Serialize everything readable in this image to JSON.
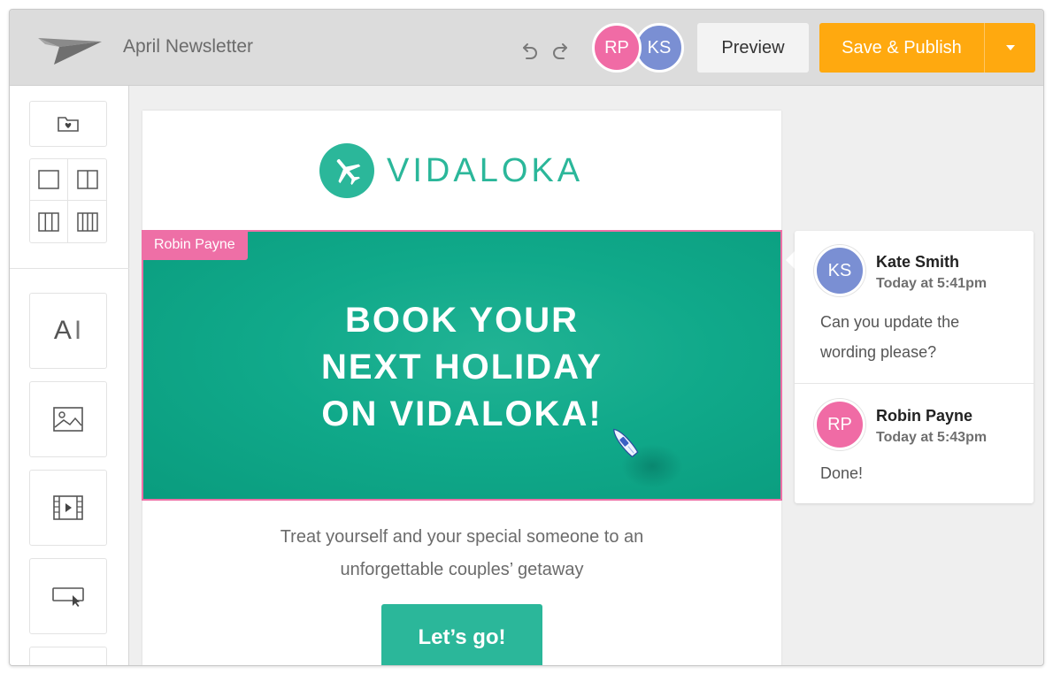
{
  "app": {
    "document_title": "April Newsletter"
  },
  "colors": {
    "accent_orange": "#ffa90f",
    "brand_teal": "#2bb79a",
    "avatar_rp": "#f06ba5",
    "avatar_ks": "#7a8fd3",
    "editor_highlight_pink": "#ee6fa6"
  },
  "toolbar": {
    "undo_icon": "undo-icon",
    "redo_icon": "redo-icon",
    "collaborators": [
      {
        "initials": "RP",
        "color": "#f06ba5"
      },
      {
        "initials": "KS",
        "color": "#7a8fd3"
      }
    ],
    "preview_label": "Preview",
    "publish_label": "Save & Publish",
    "publish_menu_icon": "caret-down-icon"
  },
  "sidebar": {
    "tools": [
      {
        "name": "saved-templates",
        "icon": "folder-heart-icon"
      },
      {
        "name": "layout-one-column",
        "icon": "layout-1col-icon"
      },
      {
        "name": "layout-two-column",
        "icon": "layout-2col-icon"
      },
      {
        "name": "layout-three-column",
        "icon": "layout-3col-icon"
      },
      {
        "name": "layout-four-column",
        "icon": "layout-4col-icon"
      },
      {
        "name": "text-block",
        "label": "A",
        "icon": "text-cursor-icon"
      },
      {
        "name": "image-block",
        "icon": "image-icon"
      },
      {
        "name": "video-block",
        "icon": "video-icon"
      },
      {
        "name": "button-block",
        "icon": "button-cursor-icon"
      }
    ]
  },
  "email": {
    "brand_name": "VIDALOKA",
    "brand_icon": "airplane-icon",
    "hero": {
      "editing_user": "Robin Payne",
      "headline_lines": [
        "BOOK YOUR",
        "NEXT HOLIDAY",
        "ON VIDALOKA!"
      ]
    },
    "tagline_lines": [
      "Treat yourself and your special someone to an",
      "unforgettable couples’ getaway"
    ],
    "cta_label": "Let’s go!"
  },
  "comments": [
    {
      "initials": "KS",
      "author": "Kate Smith",
      "time": "Today at 5:41pm",
      "text": "Can you update the wording please?"
    },
    {
      "initials": "RP",
      "author": "Robin Payne",
      "time": "Today at 5:43pm",
      "text": "Done!"
    }
  ]
}
